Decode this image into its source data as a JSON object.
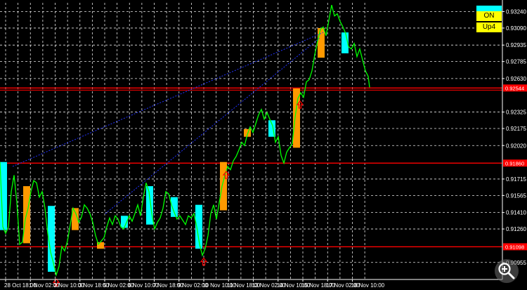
{
  "colors": {
    "background": "#000000",
    "grid": "#ffffff",
    "axis": "#ffffff",
    "axis_text": "#ffffff",
    "price_line": "#00ff00",
    "bull_block": "#00ffff",
    "bear_block": "#ff9900",
    "level_line": "#ff0000",
    "level_label_bg": "#ff0000",
    "trend_line": "#2233ff",
    "signal_arrow": "#ff0000",
    "button_top": "#00ffff",
    "button_bg": "#ffff00",
    "zoom_icon": "#ffffff"
  },
  "buttons": {
    "on_label": "ON",
    "up4_label": "Up4"
  },
  "zoom_icon": "zoom-in-icon",
  "signal_icon": "up-arrow-icon",
  "chart_data": {
    "type": "line",
    "symbol_value_range": [
      0.908,
      0.9332
    ],
    "y_ticks": [
      "0.93240",
      "0.93090",
      "0.92935",
      "0.92785",
      "0.92630",
      "0.92325",
      "0.92175",
      "0.92020",
      "0.91715",
      "0.91565",
      "0.91410",
      "0.91260",
      "0.90955"
    ],
    "y_tick_values": [
      0.9324,
      0.9309,
      0.92935,
      0.92785,
      0.9263,
      0.92325,
      0.92175,
      0.9202,
      0.91715,
      0.91565,
      0.9141,
      0.9126,
      0.90955
    ],
    "x_ticks": [
      "28 Oct 18:00",
      "1 Nov 02:00",
      "2 Nov 10:00",
      "3 Nov 18:00",
      "5 Nov 02:00",
      "6 Nov 10:00",
      "7 Nov 18:00",
      "9 Nov 02:00",
      "10 Nov 10:00",
      "11 Nov 18:00",
      "13 Nov 02:00",
      "14 Nov 10:00",
      "15 Nov 18:00",
      "17 Nov 02:00",
      "18 Nov 10:00"
    ],
    "levels": [
      0.92544,
      0.9186,
      0.91098
    ],
    "level_labels": [
      "0.92544",
      "0.91860",
      "0.91098"
    ],
    "price": [
      [
        0,
        0.9187
      ],
      [
        4,
        0.9128
      ],
      [
        8,
        0.9122
      ],
      [
        12,
        0.9128
      ],
      [
        16,
        0.916
      ],
      [
        20,
        0.9175
      ],
      [
        24,
        0.915
      ],
      [
        28,
        0.9112
      ],
      [
        32,
        0.9114
      ],
      [
        36,
        0.9135
      ],
      [
        40,
        0.9145
      ],
      [
        44,
        0.916
      ],
      [
        48,
        0.917
      ],
      [
        52,
        0.9168
      ],
      [
        56,
        0.9155
      ],
      [
        60,
        0.916
      ],
      [
        64,
        0.9145
      ],
      [
        68,
        0.9122
      ],
      [
        72,
        0.9105
      ],
      [
        76,
        0.9095
      ],
      [
        80,
        0.9084
      ],
      [
        84,
        0.9092
      ],
      [
        88,
        0.911
      ],
      [
        92,
        0.9106
      ],
      [
        96,
        0.9115
      ],
      [
        100,
        0.913
      ],
      [
        104,
        0.9145
      ],
      [
        108,
        0.914
      ],
      [
        112,
        0.9132
      ],
      [
        116,
        0.9137
      ],
      [
        120,
        0.9148
      ],
      [
        124,
        0.9145
      ],
      [
        128,
        0.914
      ],
      [
        132,
        0.9132
      ],
      [
        136,
        0.912
      ],
      [
        140,
        0.9112
      ],
      [
        144,
        0.9115
      ],
      [
        148,
        0.9118
      ],
      [
        152,
        0.9128
      ],
      [
        156,
        0.9136
      ],
      [
        160,
        0.913
      ],
      [
        164,
        0.9138
      ],
      [
        168,
        0.9135
      ],
      [
        172,
        0.9128
      ],
      [
        176,
        0.9126
      ],
      [
        180,
        0.9132
      ],
      [
        184,
        0.9138
      ],
      [
        188,
        0.9133
      ],
      [
        192,
        0.914
      ],
      [
        196,
        0.9148
      ],
      [
        200,
        0.9138
      ],
      [
        204,
        0.9155
      ],
      [
        208,
        0.9168
      ],
      [
        212,
        0.916
      ],
      [
        216,
        0.914
      ],
      [
        220,
        0.9126
      ],
      [
        224,
        0.9132
      ],
      [
        228,
        0.9136
      ],
      [
        232,
        0.9145
      ],
      [
        236,
        0.916
      ],
      [
        240,
        0.9158
      ],
      [
        244,
        0.9148
      ],
      [
        248,
        0.9141
      ],
      [
        252,
        0.9135
      ],
      [
        256,
        0.9138
      ],
      [
        260,
        0.9134
      ],
      [
        264,
        0.913
      ],
      [
        268,
        0.9138
      ],
      [
        272,
        0.9136
      ],
      [
        276,
        0.914
      ],
      [
        280,
        0.9128
      ],
      [
        284,
        0.9112
      ],
      [
        288,
        0.9102
      ],
      [
        292,
        0.9108
      ],
      [
        296,
        0.912
      ],
      [
        300,
        0.914
      ],
      [
        304,
        0.9148
      ],
      [
        308,
        0.9135
      ],
      [
        312,
        0.915
      ],
      [
        316,
        0.9165
      ],
      [
        320,
        0.9175
      ],
      [
        324,
        0.9183
      ],
      [
        328,
        0.918
      ],
      [
        332,
        0.9188
      ],
      [
        336,
        0.9192
      ],
      [
        340,
        0.9198
      ],
      [
        344,
        0.9205
      ],
      [
        348,
        0.9202
      ],
      [
        352,
        0.9212
      ],
      [
        356,
        0.9219
      ],
      [
        360,
        0.9214
      ],
      [
        364,
        0.9222
      ],
      [
        368,
        0.923
      ],
      [
        372,
        0.9235
      ],
      [
        376,
        0.9226
      ],
      [
        380,
        0.9232
      ],
      [
        384,
        0.9226
      ],
      [
        388,
        0.922
      ],
      [
        392,
        0.9205
      ],
      [
        396,
        0.921
      ],
      [
        400,
        0.9193
      ],
      [
        404,
        0.9186
      ],
      [
        408,
        0.9196
      ],
      [
        412,
        0.92
      ],
      [
        416,
        0.9204
      ],
      [
        420,
        0.9228
      ],
      [
        424,
        0.9245
      ],
      [
        428,
        0.925
      ],
      [
        432,
        0.9246
      ],
      [
        436,
        0.926
      ],
      [
        440,
        0.9262
      ],
      [
        444,
        0.927
      ],
      [
        448,
        0.9285
      ],
      [
        452,
        0.9297
      ],
      [
        456,
        0.9308
      ],
      [
        460,
        0.931
      ],
      [
        464,
        0.9302
      ],
      [
        468,
        0.9316
      ],
      [
        472,
        0.933
      ],
      [
        476,
        0.932
      ],
      [
        480,
        0.9322
      ],
      [
        484,
        0.9315
      ],
      [
        488,
        0.931
      ],
      [
        492,
        0.9304
      ],
      [
        496,
        0.9292
      ],
      [
        500,
        0.929
      ],
      [
        504,
        0.9295
      ],
      [
        508,
        0.9283
      ],
      [
        512,
        0.929
      ],
      [
        516,
        0.928
      ],
      [
        520,
        0.927
      ],
      [
        524,
        0.9265
      ],
      [
        526,
        0.9255
      ]
    ],
    "blocks": [
      {
        "kind": "bull",
        "x": 0,
        "w": 10,
        "from": 0.9187,
        "to": 0.9125
      },
      {
        "kind": "bear",
        "x": 33,
        "w": 10,
        "from": 0.9165,
        "to": 0.9113
      },
      {
        "kind": "bull",
        "x": 68,
        "w": 10,
        "from": 0.9147,
        "to": 0.9087
      },
      {
        "kind": "bear",
        "x": 102,
        "w": 10,
        "from": 0.9145,
        "to": 0.9125
      },
      {
        "kind": "bear",
        "x": 138,
        "w": 10,
        "from": 0.9114,
        "to": 0.9108
      },
      {
        "kind": "bull",
        "x": 172,
        "w": 10,
        "from": 0.9138,
        "to": 0.9127
      },
      {
        "kind": "bull",
        "x": 208,
        "w": 10,
        "from": 0.9165,
        "to": 0.913
      },
      {
        "kind": "bull",
        "x": 243,
        "w": 10,
        "from": 0.9155,
        "to": 0.9137
      },
      {
        "kind": "bull",
        "x": 278,
        "w": 10,
        "from": 0.9148,
        "to": 0.9108
      },
      {
        "kind": "bear",
        "x": 313,
        "w": 10,
        "from": 0.9187,
        "to": 0.9143
      },
      {
        "kind": "bear",
        "x": 347,
        "w": 10,
        "from": 0.9217,
        "to": 0.921
      },
      {
        "kind": "bull",
        "x": 382,
        "w": 10,
        "from": 0.9225,
        "to": 0.921
      },
      {
        "kind": "bear",
        "x": 417,
        "w": 10,
        "from": 0.9254,
        "to": 0.92
      },
      {
        "kind": "bear",
        "x": 452,
        "w": 10,
        "from": 0.9309,
        "to": 0.9282
      },
      {
        "kind": "bull",
        "x": 486,
        "w": 10,
        "from": 0.9305,
        "to": 0.9286
      }
    ],
    "trend_lines": [
      {
        "from": [
          18,
          0.9183
        ],
        "to": [
          460,
          0.9305
        ]
      },
      {
        "from": [
          150,
          0.914
        ],
        "to": [
          455,
          0.93
        ]
      }
    ],
    "arrows": [
      {
        "x": 80,
        "y": 0.9083
      },
      {
        "x": 290,
        "y": 0.9102
      },
      {
        "x": 322,
        "y": 0.9181
      },
      {
        "x": 427,
        "y": 0.9245
      }
    ],
    "grid": true
  }
}
